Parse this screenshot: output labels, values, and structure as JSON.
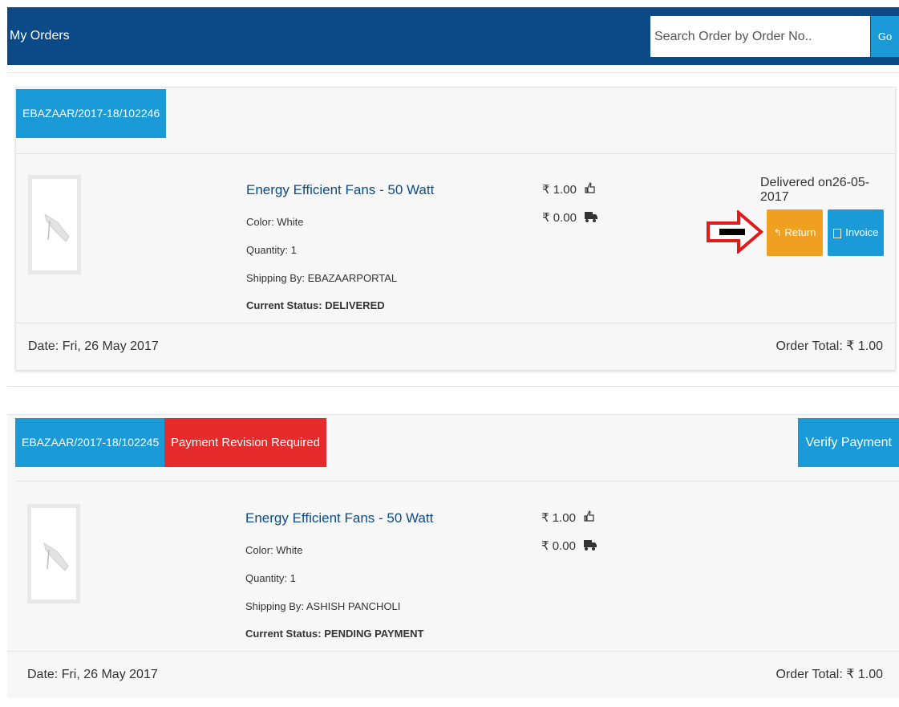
{
  "header": {
    "title": "My Orders",
    "search_placeholder": "Search Order by Order No..",
    "go_label": "Go",
    "color": "#0b4a86"
  },
  "orders": [
    {
      "order_no": "EBAZAAR/2017-18/102246",
      "product_name": "Energy Efficient Fans - 50 Watt",
      "color": "Color: White",
      "quantity": "Quantity: 1",
      "shipping": "Shipping By: EBAZAARPORTAL",
      "status": "Current Status: DELIVERED",
      "price": "₹ 1.00",
      "shipping_price": "₹ 0.00",
      "delivered": "Delivered on26-05-2017",
      "return_label": "Return",
      "invoice_label": "Invoice",
      "date": "Date: Fri, 26 May 2017",
      "total": "Order Total: ₹ 1.00"
    },
    {
      "order_no": "EBAZAAR/2017-18/102245",
      "badge": "Payment Revision Required",
      "verify_label": "Verify Payment",
      "product_name": "Energy Efficient Fans - 50 Watt",
      "color": "Color: White",
      "quantity": "Quantity: 1",
      "shipping": "Shipping By: ASHISH PANCHOLI",
      "status": "Current Status: PENDING PAYMENT",
      "price": "₹ 1.00",
      "shipping_price": "₹ 0.00",
      "date": "Date: Fri, 26 May 2017",
      "total": "Order Total: ₹ 1.00"
    }
  ],
  "colors": {
    "accent": "#1a9ad6",
    "warning": "#f0a020",
    "danger": "#e52b2b"
  },
  "icons": [
    "thumbs-up-icon",
    "truck-icon",
    "reply-icon",
    "file-icon",
    "arrow-annotation-icon"
  ]
}
